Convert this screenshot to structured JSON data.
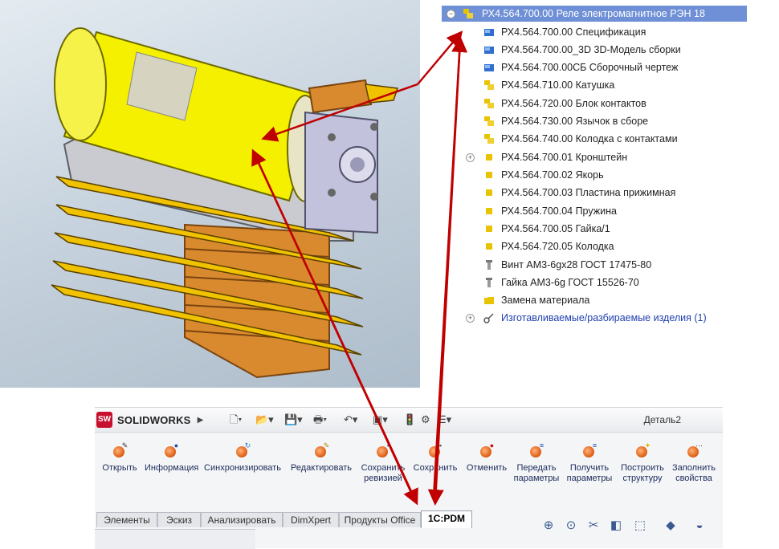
{
  "tree": {
    "root_label": "РХ4.564.700.00 Реле электромагнитное РЭН 18",
    "items": [
      {
        "label": "РХ4.564.700.00 Спецификация",
        "icon": "document-icon"
      },
      {
        "label": "РХ4.564.700.00_3D 3D-Модель сборки",
        "icon": "document-icon"
      },
      {
        "label": "РХ4.564.700.00СБ Сборочный чертеж",
        "icon": "document-icon"
      },
      {
        "label": "РХ4.564.710.00 Катушка",
        "icon": "assembly-icon"
      },
      {
        "label": "РХ4.564.720.00 Блок контактов",
        "icon": "assembly-icon"
      },
      {
        "label": "РХ4.564.730.00 Язычок в сборе",
        "icon": "assembly-icon"
      },
      {
        "label": "РХ4.564.740.00 Колодка с контактами",
        "icon": "assembly-icon"
      },
      {
        "label": "РХ4.564.700.01 Кронштейн",
        "icon": "part-icon"
      },
      {
        "label": "РХ4.564.700.02 Якорь",
        "icon": "part-icon"
      },
      {
        "label": "РХ4.564.700.03 Пластина прижимная",
        "icon": "part-icon"
      },
      {
        "label": "РХ4.564.700.04 Пружина",
        "icon": "part-icon"
      },
      {
        "label": "РХ4.564.700.05 Гайка/1",
        "icon": "part-icon"
      },
      {
        "label": "РХ4.564.720.05 Колодка",
        "icon": "part-icon"
      },
      {
        "label": "Винт АМ3-6gх28 ГОСТ 17475-80",
        "icon": "screw-icon"
      },
      {
        "label": "Гайка АМ3-6g  ГОСТ 15526-70",
        "icon": "screw-icon"
      },
      {
        "label": "Замена материала",
        "icon": "folder-icon"
      },
      {
        "label": "Изготавливаемые/разбираемые изделия (1)",
        "icon": "link-icon"
      }
    ]
  },
  "solidworks": {
    "logo_text": "SOLIDWORKS",
    "logo_mark": "SW",
    "document_title": "Деталь2",
    "commands": [
      {
        "label": "Открыть"
      },
      {
        "label": "Информация"
      },
      {
        "label": "Синхронизировать"
      },
      {
        "label": "Редактировать"
      },
      {
        "label": "Сохранить ревизией"
      },
      {
        "label": "Сохранить"
      },
      {
        "label": "Отменить"
      },
      {
        "label": "Передать параметры"
      },
      {
        "label": "Получить параметры"
      },
      {
        "label": "Построить структуру"
      },
      {
        "label": "Заполнить свойства"
      }
    ],
    "tabs": [
      "Элементы",
      "Эскиз",
      "Анализировать",
      "DimXpert",
      "Продукты Office",
      "1С:PDM"
    ],
    "active_tab": "1С:PDM"
  },
  "colors": {
    "selection": "#6f8fd6",
    "annotation_arrow": "#c00000",
    "coil_yellow": "#f4f000",
    "contact_orange": "#d98a2e"
  }
}
